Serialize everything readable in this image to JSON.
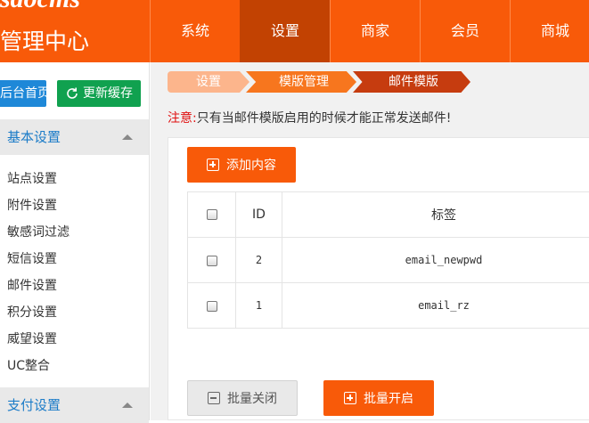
{
  "header": {
    "logo_text": "sdocms",
    "title": "管理中心",
    "nav": [
      {
        "label": "系统"
      },
      {
        "label": "设置"
      },
      {
        "label": "商家"
      },
      {
        "label": "会员"
      },
      {
        "label": "商城"
      }
    ],
    "active_nav": "设置",
    "colors": {
      "brand": "#f85a09",
      "active": "#c24202"
    }
  },
  "sidebar": {
    "home_button": "后台首页",
    "refresh_button": "更新缓存",
    "group_basic": "基本设置",
    "items": [
      {
        "label": "站点设置"
      },
      {
        "label": "附件设置"
      },
      {
        "label": "敏感词过滤"
      },
      {
        "label": "短信设置"
      },
      {
        "label": "邮件设置"
      },
      {
        "label": "积分设置"
      },
      {
        "label": "威望设置"
      },
      {
        "label": "UC整合"
      }
    ],
    "group_pay": "支付设置"
  },
  "main": {
    "breadcrumb": [
      "设置",
      "模版管理",
      "邮件模版"
    ],
    "notice_label": "注意:",
    "notice_text": "只有当邮件模版启用的时候才能正常发送邮件!",
    "add_button": "添加内容",
    "table": {
      "headers": {
        "id": "ID",
        "tag": "标签"
      },
      "rows": [
        {
          "id": "2",
          "tag": "email_newpwd"
        },
        {
          "id": "1",
          "tag": "email_rz"
        }
      ]
    },
    "batch_close": "批量关闭",
    "batch_open": "批量开启"
  }
}
